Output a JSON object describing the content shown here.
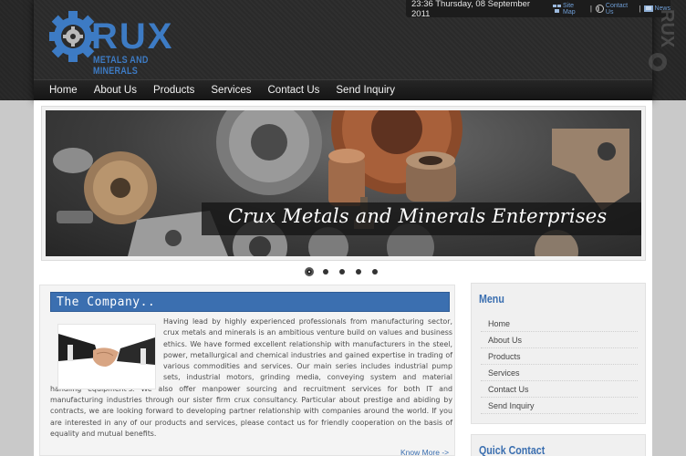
{
  "header": {
    "logo": {
      "wordmark": "RUX",
      "subtitle": "METALS AND MINERALS"
    },
    "topbar": {
      "datetime": "23:36 Thursday, 08 September 2011",
      "links": [
        {
          "label": "Site Map",
          "icon": "sitemap-icon"
        },
        {
          "label": "Contact Us",
          "icon": "phone-icon"
        },
        {
          "label": "News",
          "icon": "news-icon"
        }
      ]
    },
    "nav": [
      "Home",
      "About Us",
      "Products",
      "Services",
      "Contact Us",
      "Send Inquiry"
    ]
  },
  "slider": {
    "caption": "Crux Metals and Minerals Enterprises",
    "slide_count": 5,
    "active_slide": 1
  },
  "company": {
    "title": "The Company..",
    "body": "Having lead by highly experienced professionals from manufacturing sector, crux metals and minerals is an ambitious venture build on values and business ethics. We have formed excellent relationship with manufacturers in the steel, power, metallurgical and chemical industries and gained expertise in trading of various commodities and services. Our main series includes industrial pump sets, industrial motors, grinding media, conveying system and material handling equipment's. We also offer manpower sourcing and recruitment services for both IT and manufacturing industries through our sister firm crux consultancy. Particular about prestige and abiding by contracts, we are looking forward to developing partner relationship with companies around the world. If you are interested in any of our products and services, please contact us for friendly cooperation on the basis of equality and mutual benefits.",
    "know_more": "Know More ->"
  },
  "sidebar": {
    "menu_heading": "Menu",
    "menu_items": [
      "Home",
      "About Us",
      "Products",
      "Services",
      "Contact Us",
      "Send Inquiry"
    ],
    "quick_contact_heading": "Quick Contact"
  },
  "colors": {
    "brand_blue": "#3b6fb0",
    "header_dark": "#2b2b2b"
  }
}
